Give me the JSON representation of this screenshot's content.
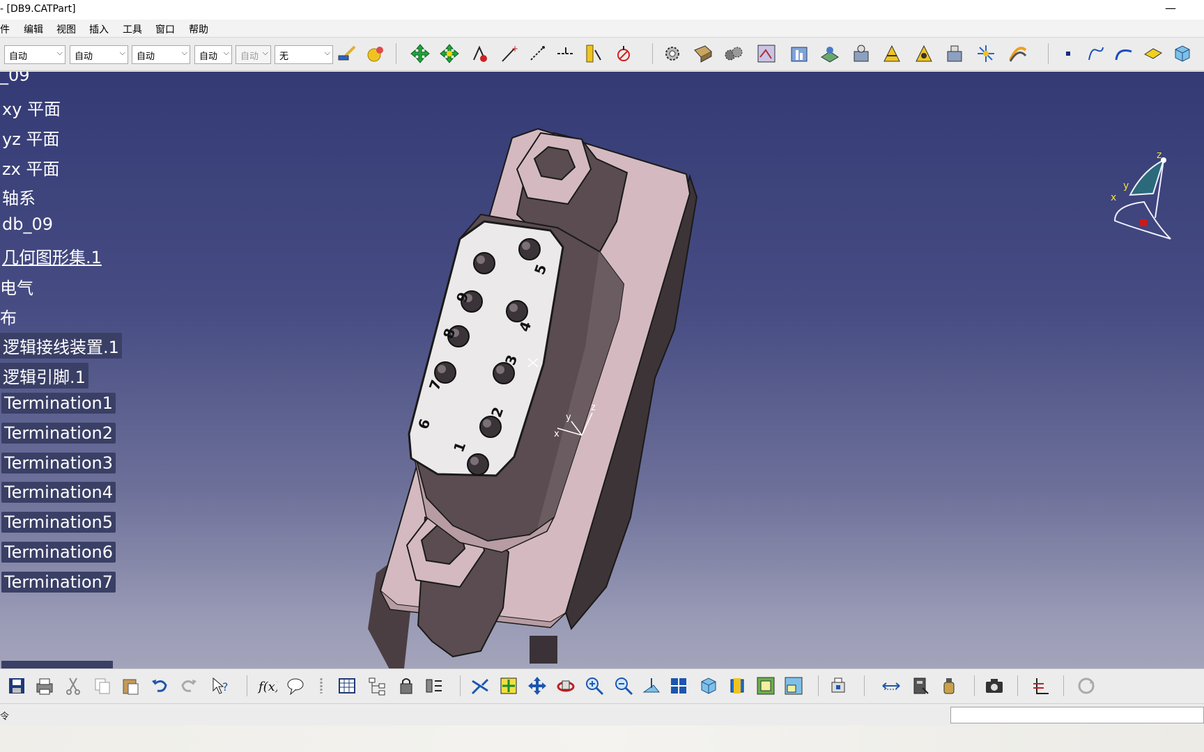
{
  "window": {
    "title": "- [DB9.CATPart]",
    "minimize_glyph": "—"
  },
  "menu": {
    "items": [
      "件",
      "编辑",
      "视图",
      "插入",
      "工具",
      "窗口",
      "帮助"
    ]
  },
  "format_toolbar": {
    "combos": [
      {
        "value": "自动",
        "enabled": true
      },
      {
        "value": "自动",
        "enabled": true
      },
      {
        "value": "自动",
        "enabled": true
      },
      {
        "value": "自动",
        "enabled": true
      },
      {
        "value": "自动",
        "enabled": false
      },
      {
        "value": "无",
        "enabled": true
      }
    ],
    "icons": [
      "paintbrush-icon",
      "painter-ball-icon",
      "move-cross-icon",
      "rotate-cross-icon",
      "snap-icon",
      "point-icon",
      "line-icon",
      "axis-icon",
      "ruler-icon",
      "measure-icon",
      "gear-icon",
      "part-design-icon",
      "generative-shape-icon",
      "knowledge-icon",
      "catalog-icon",
      "electrical-icon",
      "harness-icon",
      "connector-icon",
      "device-icon",
      "fitting-icon",
      "bundle-icon",
      "wire-icon",
      "dot-icon",
      "spline-icon",
      "arc-icon",
      "plane-icon",
      "cube-icon"
    ]
  },
  "spec_tree": {
    "items": [
      {
        "label": "_09",
        "boxed": false,
        "underline": false
      },
      {
        "label": "xy 平面",
        "boxed": false,
        "underline": false
      },
      {
        "label": "yz 平面",
        "boxed": false,
        "underline": false
      },
      {
        "label": "zx 平面",
        "boxed": false,
        "underline": false
      },
      {
        "label": "轴系",
        "boxed": false,
        "underline": false
      },
      {
        "label": "db_09",
        "boxed": false,
        "underline": false
      },
      {
        "label": "几何图形集.1",
        "boxed": false,
        "underline": true
      },
      {
        "label": "电气",
        "boxed": false,
        "underline": false
      },
      {
        "label": "布",
        "boxed": false,
        "underline": false
      },
      {
        "label": "逻辑接线装置.1",
        "boxed": true,
        "underline": false
      },
      {
        "label": "逻辑引脚.1",
        "boxed": true,
        "underline": false
      },
      {
        "label": "Termination1",
        "boxed": true,
        "underline": false
      },
      {
        "label": "Termination2",
        "boxed": true,
        "underline": false
      },
      {
        "label": "Termination3",
        "boxed": true,
        "underline": false
      },
      {
        "label": "Termination4",
        "boxed": true,
        "underline": false
      },
      {
        "label": "Termination5",
        "boxed": true,
        "underline": false
      },
      {
        "label": "Termination6",
        "boxed": true,
        "underline": false
      },
      {
        "label": "Termination7",
        "boxed": true,
        "underline": false
      }
    ]
  },
  "compass": {
    "x_label": "x",
    "y_label": "y",
    "z_label": "z"
  },
  "model": {
    "pin_labels": [
      "1",
      "2",
      "3",
      "4",
      "5",
      "6",
      "7",
      "8",
      "9"
    ],
    "axis_labels": {
      "x": "x",
      "y": "y",
      "z": "z"
    },
    "colors": {
      "body": "#d4bac0",
      "shell": "#5a4c50",
      "face": "#ece9ea",
      "edge": "#1a1a1a"
    }
  },
  "standard_toolbar": {
    "icons": [
      "save-icon",
      "print-icon",
      "cut-icon",
      "copy-icon",
      "paste-icon",
      "undo-icon",
      "redo-icon",
      "whats-this-icon",
      "formula-icon",
      "comment-icon",
      "link-icon",
      "table-icon",
      "tree-icon",
      "lock-icon",
      "align-icon",
      "fly-mode-icon",
      "fit-all-icon",
      "pan-icon",
      "rotate-icon",
      "zoom-in-icon",
      "zoom-out-icon",
      "normal-view-icon",
      "multi-view-icon",
      "iso-view-icon",
      "shading-icon",
      "hide-show-icon",
      "swap-visible-icon",
      "render-icon",
      "dimension-icon",
      "catalog-browser-icon",
      "bottle-icon",
      "camera-icon",
      "axis-system-icon",
      "update-icon"
    ]
  },
  "status": {
    "prompt": "令",
    "command_input_value": ""
  }
}
